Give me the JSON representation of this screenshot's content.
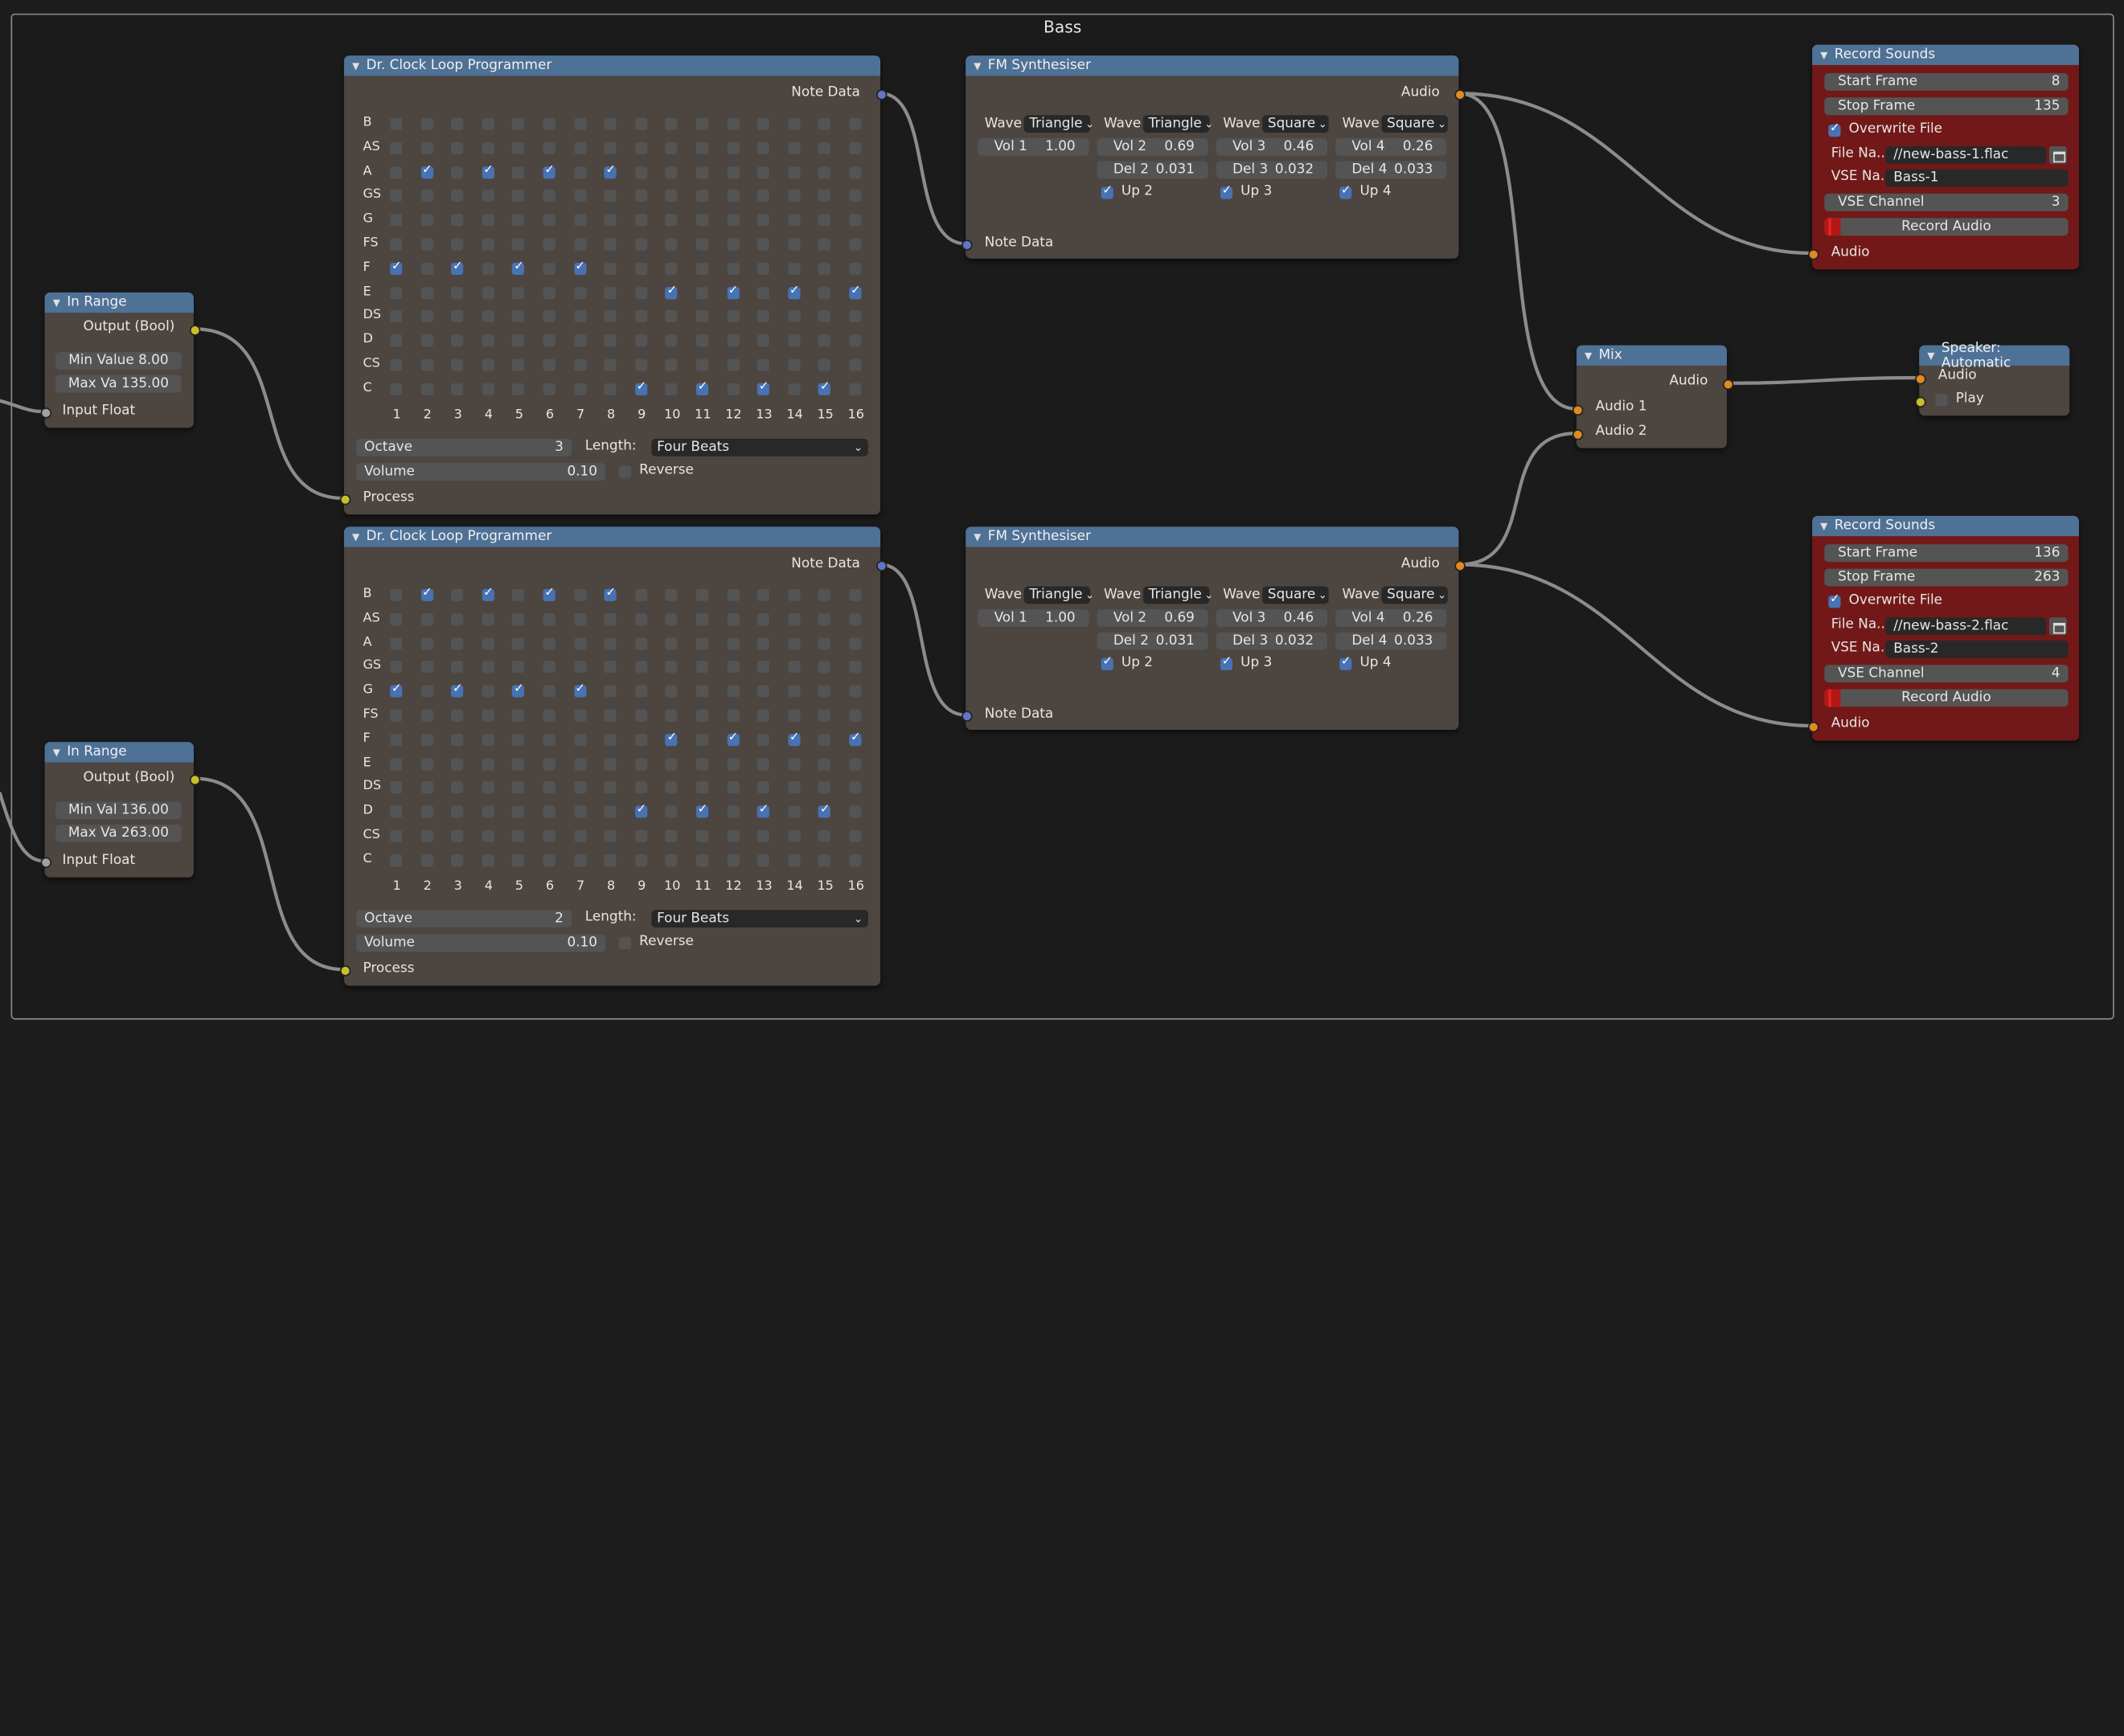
{
  "frame": {
    "title": "Bass"
  },
  "in_range_1": {
    "title": "In Range",
    "output": "Output (Bool)",
    "min": "Min Value  8.00",
    "max": "Max Va  135.00",
    "input": "Input Float"
  },
  "in_range_2": {
    "title": "In Range",
    "output": "Output (Bool)",
    "min": "Min Val  136.00",
    "max": "Max Va  263.00",
    "input": "Input Float"
  },
  "loop_1": {
    "title": "Dr. Clock Loop Programmer",
    "note_data": "Note Data",
    "rows": [
      "B",
      "AS",
      "A",
      "GS",
      "G",
      "FS",
      "F",
      "E",
      "DS",
      "D",
      "CS",
      "C"
    ],
    "columns": [
      "1",
      "2",
      "3",
      "4",
      "5",
      "6",
      "7",
      "8",
      "9",
      "10",
      "11",
      "12",
      "13",
      "14",
      "15",
      "16"
    ],
    "checked": {
      "A": [
        2,
        4,
        6,
        8
      ],
      "F": [
        1,
        3,
        5,
        7
      ],
      "E": [
        10,
        12,
        14,
        16
      ],
      "C": [
        9,
        11,
        13,
        15
      ]
    },
    "octave_label": "Octave",
    "octave_value": "3",
    "length_label": "Length:",
    "length_value": "Four Beats",
    "volume_label": "Volume",
    "volume_value": "0.10",
    "reverse_label": "Reverse",
    "reverse_checked": false,
    "process": "Process"
  },
  "loop_2": {
    "title": "Dr. Clock Loop Programmer",
    "note_data": "Note Data",
    "rows": [
      "B",
      "AS",
      "A",
      "GS",
      "G",
      "FS",
      "F",
      "E",
      "DS",
      "D",
      "CS",
      "C"
    ],
    "columns": [
      "1",
      "2",
      "3",
      "4",
      "5",
      "6",
      "7",
      "8",
      "9",
      "10",
      "11",
      "12",
      "13",
      "14",
      "15",
      "16"
    ],
    "checked": {
      "B": [
        2,
        4,
        6,
        8
      ],
      "G": [
        1,
        3,
        5,
        7
      ],
      "F": [
        10,
        12,
        14,
        16
      ],
      "D": [
        9,
        11,
        13,
        15
      ]
    },
    "octave_label": "Octave",
    "octave_value": "2",
    "length_label": "Length:",
    "length_value": "Four Beats",
    "volume_label": "Volume",
    "volume_value": "0.10",
    "reverse_label": "Reverse",
    "reverse_checked": false,
    "process": "Process"
  },
  "fm_1": {
    "title": "FM Synthesiser",
    "audio": "Audio",
    "note_data": "Note Data",
    "wave_label": "Wave",
    "waves": [
      "Triangle",
      "Triangle",
      "Square",
      "Square"
    ],
    "vol_labels": [
      "Vol 1",
      "Vol 2",
      "Vol 3",
      "Vol 4"
    ],
    "vols": [
      "1.00",
      "0.69",
      "0.46",
      "0.26"
    ],
    "del_labels": [
      "Del 2",
      "Del 3",
      "Del 4"
    ],
    "dels": [
      "0.031",
      "0.032",
      "0.033"
    ],
    "up_labels": [
      "Up 2",
      "Up 3",
      "Up 4"
    ]
  },
  "fm_2": {
    "title": "FM Synthesiser",
    "audio": "Audio",
    "note_data": "Note Data",
    "wave_label": "Wave",
    "waves": [
      "Triangle",
      "Triangle",
      "Square",
      "Square"
    ],
    "vol_labels": [
      "Vol 1",
      "Vol 2",
      "Vol 3",
      "Vol 4"
    ],
    "vols": [
      "1.00",
      "0.69",
      "0.46",
      "0.26"
    ],
    "del_labels": [
      "Del 2",
      "Del 3",
      "Del 4"
    ],
    "dels": [
      "0.031",
      "0.032",
      "0.033"
    ],
    "up_labels": [
      "Up 2",
      "Up 3",
      "Up 4"
    ]
  },
  "mix": {
    "title": "Mix",
    "audio": "Audio",
    "in1": "Audio 1",
    "in2": "Audio 2"
  },
  "speaker": {
    "title": "Speaker: Automatic",
    "audio": "Audio",
    "play": "Play"
  },
  "rec_1": {
    "title": "Record Sounds",
    "start_label": "Start Frame",
    "start": "8",
    "stop_label": "Stop Frame",
    "stop": "135",
    "overwrite": "Overwrite File",
    "file_label": "File Na..",
    "file": "//new-bass-1.flac",
    "vse_label": "VSE Na..",
    "vse": "Bass-1",
    "channel_label": "VSE Channel",
    "channel": "3",
    "record": "Record Audio",
    "audio": "Audio"
  },
  "rec_2": {
    "title": "Record Sounds",
    "start_label": "Start Frame",
    "start": "136",
    "stop_label": "Stop Frame",
    "stop": "263",
    "overwrite": "Overwrite File",
    "file_label": "File Na..",
    "file": "//new-bass-2.flac",
    "vse_label": "VSE Na..",
    "vse": "Bass-2",
    "channel_label": "VSE Channel",
    "channel": "4",
    "record": "Record Audio",
    "audio": "Audio"
  },
  "colors": {
    "header": "#4e7196",
    "node": "#4d4540",
    "record_node": "#731818",
    "link": "#8c8c8c"
  }
}
